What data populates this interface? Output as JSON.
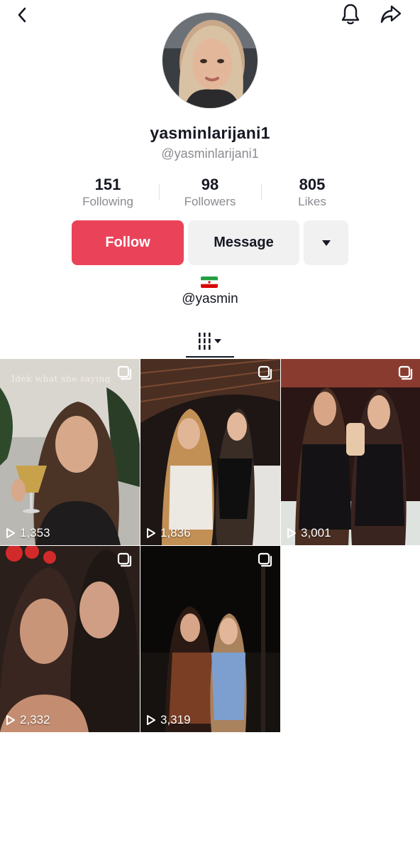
{
  "header": {
    "back_icon": "chevron-left-icon",
    "bell_icon": "bell-icon",
    "share_icon": "share-arrow-icon"
  },
  "profile": {
    "display_name": "yasminlarijani1",
    "handle": "@yasminlarijani1",
    "stats": [
      {
        "value": "151",
        "label": "Following"
      },
      {
        "value": "98",
        "label": "Followers"
      },
      {
        "value": "805",
        "label": "Likes"
      }
    ],
    "bio_link": "@yasmin"
  },
  "actions": {
    "follow_label": "Follow",
    "message_label": "Message",
    "more_icon": "caret-down-icon",
    "follow_color": "#ea4359"
  },
  "tabs": {
    "videos_icon": "grid-bars-icon"
  },
  "videos": [
    {
      "views": "1,353",
      "caption": "Idek what she saying"
    },
    {
      "views": "1,836"
    },
    {
      "views": "3,001"
    },
    {
      "views": "2,332"
    },
    {
      "views": "3,319"
    }
  ]
}
